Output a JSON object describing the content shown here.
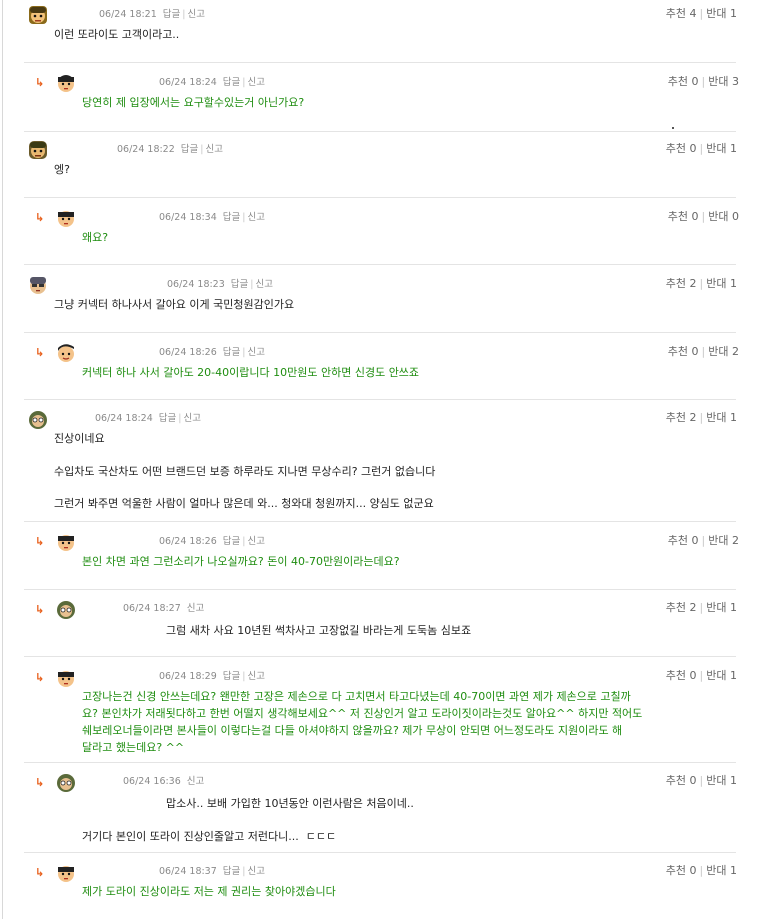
{
  "labels": {
    "reply": "답글",
    "report": "신고",
    "rec": "추천",
    "opp": "반대"
  },
  "comments": [
    {
      "time": "06/24 18:21",
      "rec": "4",
      "opp": "1",
      "lines": [
        "이런 또라이도 고객이라고.."
      ]
    },
    {
      "time": "06/24 18:24",
      "rec": "0",
      "opp": "3",
      "lines": [
        "당연히 제 입장에서는 요구할수있는거 아닌가요?"
      ]
    },
    {
      "time": "06/24 18:22",
      "rec": "0",
      "opp": "1",
      "lines": [
        "엥?"
      ]
    },
    {
      "time": "06/24 18:34",
      "rec": "0",
      "opp": "0",
      "lines": [
        "왜요?"
      ]
    },
    {
      "time": "06/24 18:23",
      "rec": "2",
      "opp": "1",
      "lines": [
        "그냥 커넥터 하나사서 갈아요 이게 국민청원감인가요"
      ]
    },
    {
      "time": "06/24 18:26",
      "rec": "0",
      "opp": "2",
      "lines": [
        "커넥터 하나 사서 갈아도 20-40이랍니다 10만원도 안하면 신경도 안쓰죠"
      ]
    },
    {
      "time": "06/24 18:24",
      "rec": "2",
      "opp": "1",
      "lines": [
        "진상이네요",
        "수입차도 국산차도 어떤 브랜드던 보증 하루라도 지나면 무상수리? 그런거 없습니다",
        "그런거 봐주면 억울한 사람이 얼마나 많은데 와... 청와대 청원까지... 양심도 없군요"
      ]
    },
    {
      "time": "06/24 18:26",
      "rec": "0",
      "opp": "2",
      "lines": [
        "본인 차면 과연 그런소리가 나오실까요? 돈이 40-70만원이라는데요?"
      ]
    },
    {
      "time": "06/24 18:27",
      "rec": "2",
      "opp": "1",
      "lines": [
        "그럼 새차 사요 10년된 썩차사고 고장없길 바라는게 도둑놈 심보죠"
      ]
    },
    {
      "time": "06/24 18:29",
      "rec": "0",
      "opp": "1",
      "lines": [
        "고장나는건 신경 안쓰는데요? 왠만한 고장은 제손으로 다 고치면서 타고다녔는데 40-70이면 과연 제가 제손으로 고칠까",
        "요? 본인차가 저래됫다하고 한번 어떨지 생각해보세요^^ 저 진상인거 알고 도라이짓이라는것도 알아요^^ 하지만 적어도",
        "쉐보레오너들이라면 본사들이 이렇다는걸 다들 아셔야하지 않을까요? 제가 무상이 안되면 어느정도라도 지원이라도 해",
        "달라고 했는데요? ^^"
      ]
    },
    {
      "time": "06/24 16:36",
      "rec": "0",
      "opp": "1",
      "lines": [
        "맙소사.. 보배 가입한 10년동안 이런사람은 처음이네..",
        "거기다 본인이 또라이 진상인줄알고 저런다니...  ㄷㄷㄷ"
      ]
    },
    {
      "time": "06/24 18:37",
      "rec": "0",
      "opp": "1",
      "lines": [
        "제가 도라이 진상이라도 저는 제 권리는 찾아야겠습니다"
      ]
    }
  ],
  "colors": {
    "reply_text": "#1f8d10",
    "arrow": "#e8601c",
    "meta": "#8a8a8a"
  }
}
